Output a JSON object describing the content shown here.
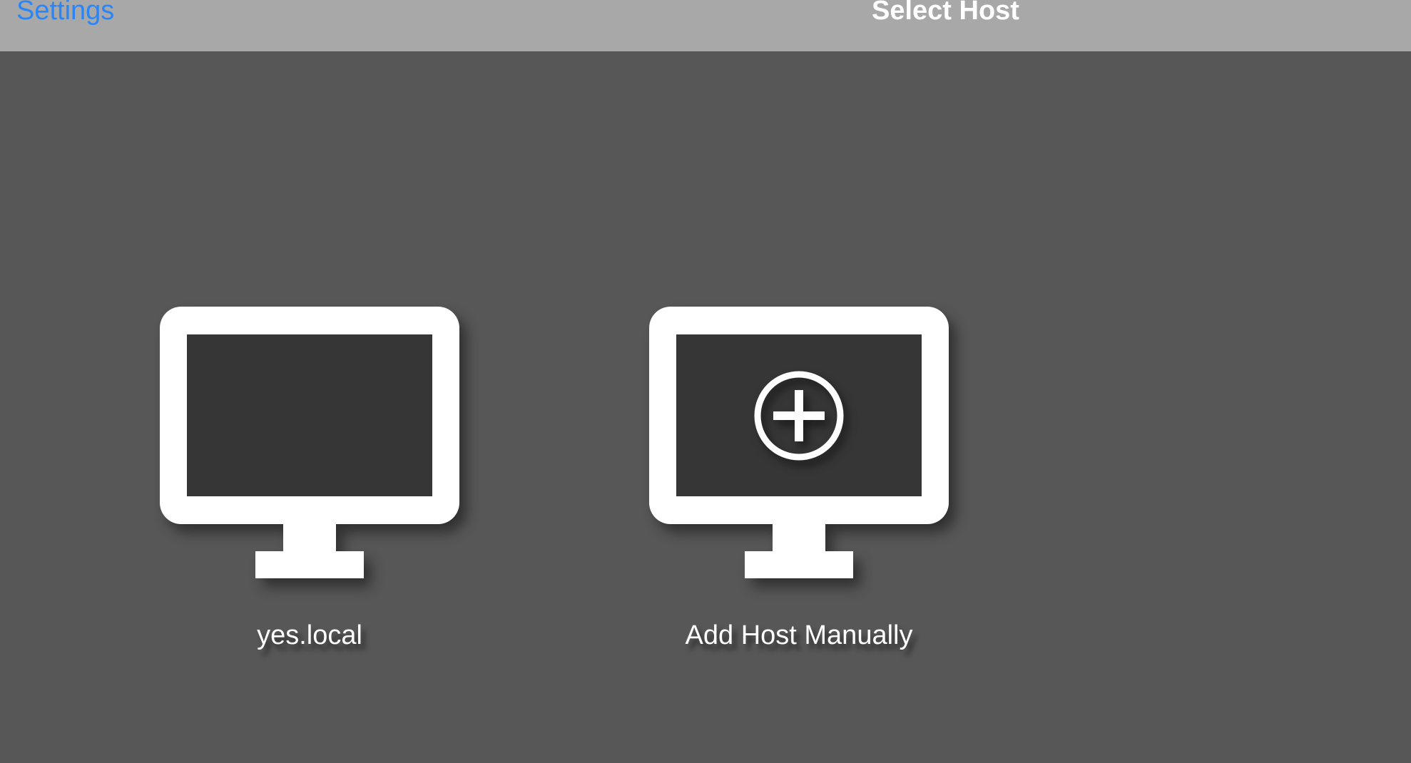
{
  "navbar": {
    "back_label": "Settings",
    "title": "Select Host"
  },
  "hosts": [
    {
      "label": "yes.local",
      "icon": "monitor-icon"
    },
    {
      "label": "Add Host Manually",
      "icon": "monitor-add-icon"
    }
  ],
  "colors": {
    "background": "#575757",
    "navbar": "#a8a8a8",
    "accent": "#2a86f7",
    "screen": "#363636",
    "icon": "#ffffff"
  }
}
